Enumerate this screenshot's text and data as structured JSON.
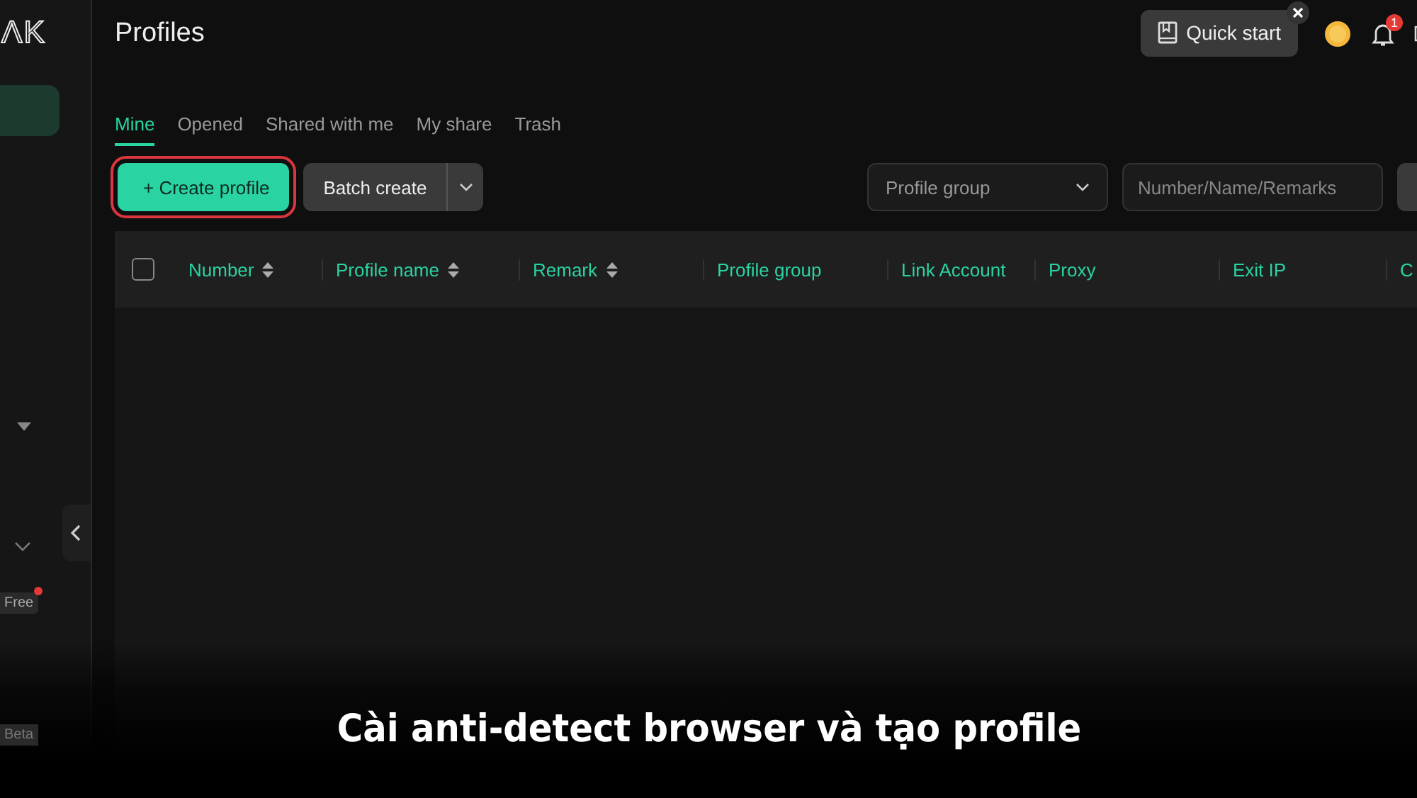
{
  "sidebar": {
    "logo_text": "ΛK",
    "free_badge": "Free",
    "beta_badge": "Beta"
  },
  "header": {
    "title": "Profiles",
    "quick_start": "Quick start",
    "notification_count": "1"
  },
  "tabs": [
    {
      "label": "Mine",
      "selected": true
    },
    {
      "label": "Opened",
      "selected": false
    },
    {
      "label": "Shared with me",
      "selected": false
    },
    {
      "label": "My share",
      "selected": false
    },
    {
      "label": "Trash",
      "selected": false
    }
  ],
  "toolbar": {
    "create_button": "+ Create profile",
    "batch_button": "Batch create",
    "group_select": "Profile group",
    "search": {
      "placeholder": "Number/Name/Remarks"
    }
  },
  "table": {
    "select_all_checked": false,
    "columns": [
      {
        "label": "Number",
        "sortable": true
      },
      {
        "label": "Profile name",
        "sortable": true
      },
      {
        "label": "Remark",
        "sortable": true
      },
      {
        "label": "Profile group",
        "sortable": false
      },
      {
        "label": "Link Account",
        "sortable": false
      },
      {
        "label": "Proxy",
        "sortable": false
      },
      {
        "label": "Exit IP",
        "sortable": false
      },
      {
        "label": "C",
        "sortable": false
      }
    ]
  },
  "caption": "Cài anti-detect browser và tạo profile"
}
